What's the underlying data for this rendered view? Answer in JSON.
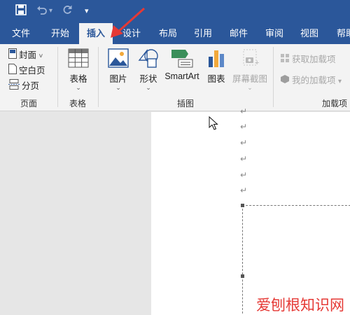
{
  "quick_access": {
    "undo_redo": "⋅",
    "more": "▾"
  },
  "tabs": [
    {
      "label": "文件"
    },
    {
      "label": "开始"
    },
    {
      "label": "插入"
    },
    {
      "label": "设计"
    },
    {
      "label": "布局"
    },
    {
      "label": "引用"
    },
    {
      "label": "邮件"
    },
    {
      "label": "审阅"
    },
    {
      "label": "视图"
    },
    {
      "label": "帮助"
    }
  ],
  "ribbon": {
    "pages": {
      "cover": "封面",
      "cover_caret": "˅",
      "blank": "空白页",
      "break": "分页",
      "group": "页面"
    },
    "tables": {
      "table": "表格",
      "group": "表格"
    },
    "illustrations": {
      "picture": "图片",
      "shapes": "形状",
      "smartart": "SmartArt",
      "chart": "图表",
      "screenshot": "屏幕截图",
      "group": "插图"
    },
    "addins": {
      "get": "获取加载项",
      "mine": "我的加载项",
      "group": "加载项"
    }
  },
  "document": {
    "para_mark": "↵"
  },
  "watermark": {
    "text": "爱刨根知识网"
  },
  "colors": {
    "accent": "#2b579a",
    "arrow": "#e53935"
  }
}
